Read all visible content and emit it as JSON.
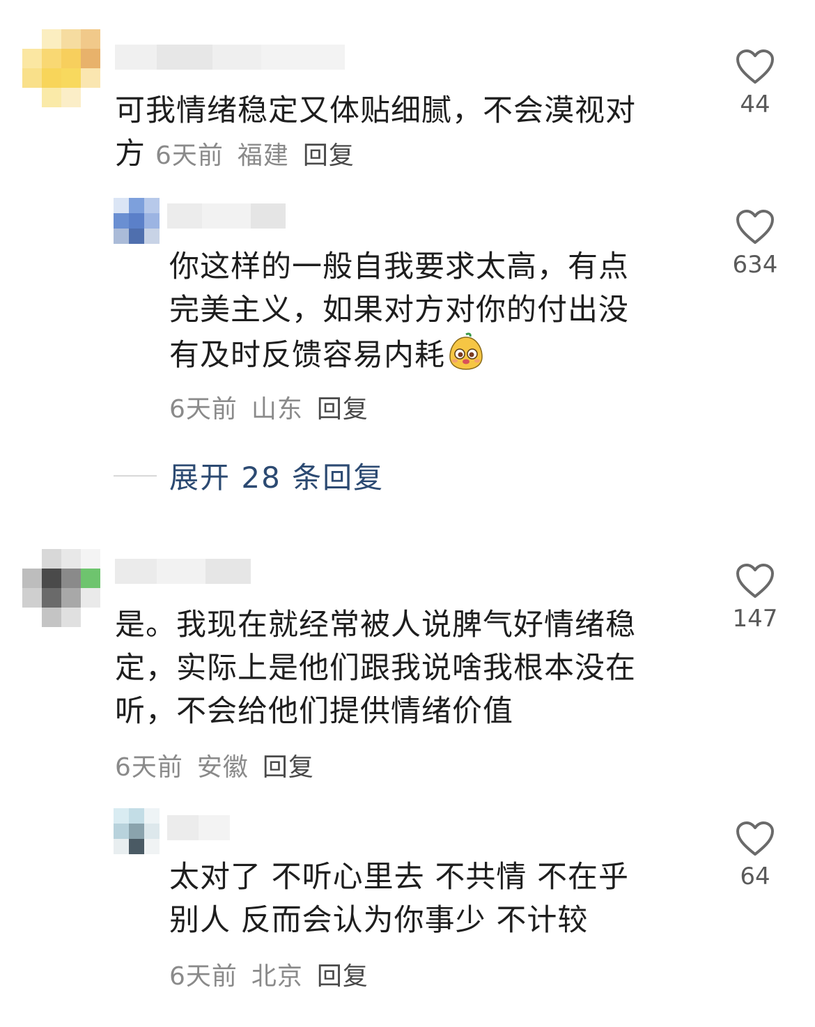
{
  "comments": [
    {
      "text": "可我情绪稳定又体贴细腻，不会漠视对方",
      "text_line1": "可我情绪稳定又体贴细腻，不会漠视对",
      "text_line2": "方",
      "time": "6天前",
      "location": "福建",
      "reply": "回复",
      "likes": "44"
    },
    {
      "text_line1": "你这样的一般自我要求太高，有点",
      "text_line2": "完美主义，如果对方对你的付出没",
      "text_line3": "有及时反馈容易内耗",
      "time": "6天前",
      "location": "山东",
      "reply": "回复",
      "likes": "634",
      "emoji": "mango-face-emoji"
    },
    {
      "text_line1": "是。我现在就经常被人说脾气好情绪稳",
      "text_line2": "定，实际上是他们跟我说啥我根本没在",
      "text_line3": "听，不会给他们提供情绪价值",
      "time": "6天前",
      "location": "安徽",
      "reply": "回复",
      "likes": "147"
    },
    {
      "text_line1": "太对了 不听心里去 不共情 不在乎",
      "text_line2": "别人 反而会认为你事少 不计较",
      "time": "6天前",
      "location": "北京",
      "reply": "回复",
      "likes": "64"
    }
  ],
  "expand_replies": "展开 28 条回复",
  "colors": {
    "link": "#2c4a72",
    "meta": "#8a8a8a",
    "heart_stroke": "#6a6a6a"
  },
  "icons": {
    "like": "heart-outline-icon"
  }
}
